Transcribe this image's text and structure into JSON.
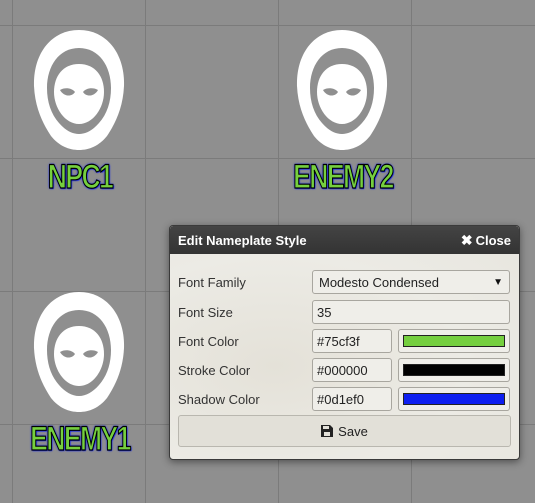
{
  "tokens": [
    {
      "name": "NPC1"
    },
    {
      "name": "ENEMY2"
    },
    {
      "name": "ENEMY1"
    }
  ],
  "dialog": {
    "title": "Edit Nameplate Style",
    "close_label": "Close",
    "fields": {
      "font_family": {
        "label": "Font Family",
        "value": "Modesto Condensed"
      },
      "font_size": {
        "label": "Font Size",
        "value": "35"
      },
      "font_color": {
        "label": "Font Color",
        "value": "#75cf3f",
        "swatch": "#75cf3f"
      },
      "stroke_color": {
        "label": "Stroke Color",
        "value": "#000000",
        "swatch": "#000000"
      },
      "shadow_color": {
        "label": "Shadow Color",
        "value": "#0d1ef0",
        "swatch": "#0d1ef0"
      }
    },
    "save_label": "Save"
  },
  "icons": {
    "close": "close-icon",
    "save": "floppy-disk-icon",
    "dropdown": "chevron-down-icon",
    "token": "hooded-figure-icon"
  }
}
